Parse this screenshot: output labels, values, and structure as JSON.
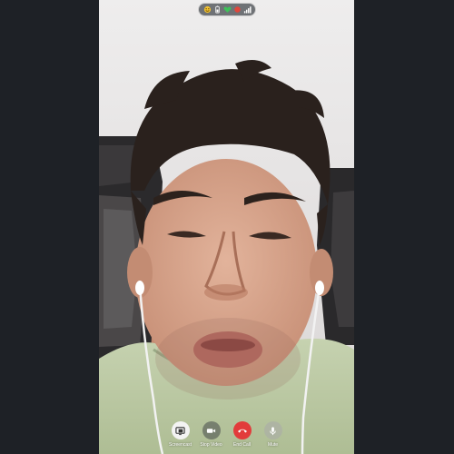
{
  "call": {
    "status_icons": [
      "emoji-icon",
      "battery-icon",
      "heart-icon",
      "signal-icon"
    ]
  },
  "controls": [
    {
      "label": "Screencast",
      "icon": "screencast-icon"
    },
    {
      "label": "Stop Video",
      "icon": "video-camera-icon"
    },
    {
      "label": "End Call",
      "icon": "end-call-icon"
    },
    {
      "label": "Mute",
      "icon": "microphone-icon"
    }
  ],
  "colors": {
    "background": "#1e2126",
    "end_call": "#e23b3b",
    "video_wall": "#e6e4e4",
    "shirt": "#b9c7a2"
  }
}
